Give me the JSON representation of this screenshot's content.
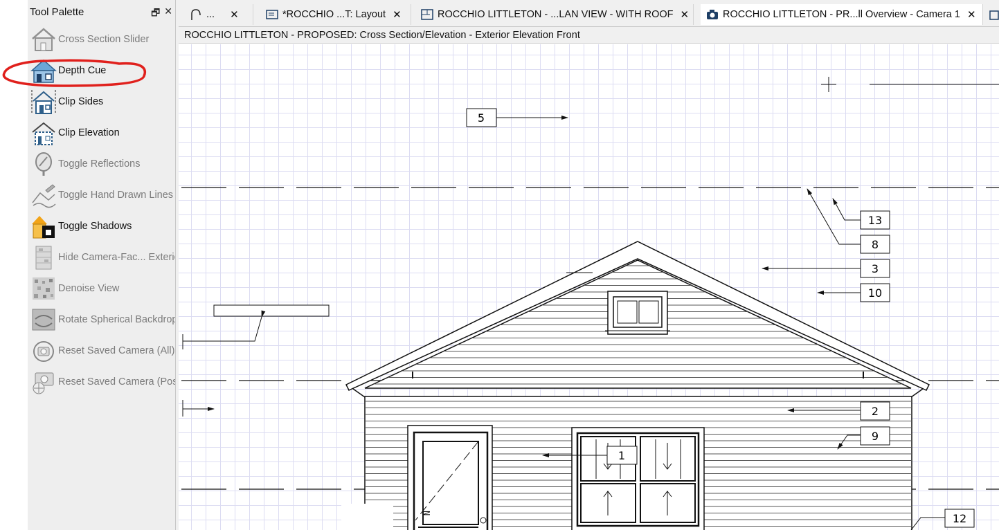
{
  "palette": {
    "title": "Tool Palette",
    "items": [
      {
        "label": "Cross Section Slider",
        "icon": "cross-section-slider-icon",
        "enabled": false
      },
      {
        "label": "Depth Cue",
        "icon": "depth-cue-icon",
        "enabled": true
      },
      {
        "label": "Clip Sides",
        "icon": "clip-sides-icon",
        "enabled": true
      },
      {
        "label": "Clip Elevation",
        "icon": "clip-elevation-icon",
        "enabled": true
      },
      {
        "label": "Toggle Reflections",
        "icon": "reflections-icon",
        "enabled": false
      },
      {
        "label": "Toggle Hand Drawn Lines",
        "icon": "hand-drawn-lines-icon",
        "enabled": false
      },
      {
        "label": "Toggle Shadows",
        "icon": "shadows-icon",
        "enabled": true
      },
      {
        "label": "Hide Camera-Fac... Exterior",
        "icon": "hide-camera-facing-icon",
        "enabled": false
      },
      {
        "label": "Denoise View",
        "icon": "denoise-icon",
        "enabled": false
      },
      {
        "label": "Rotate Spherical Backdrop",
        "icon": "rotate-backdrop-icon",
        "enabled": false
      },
      {
        "label": "Reset Saved Camera (All)",
        "icon": "reset-camera-icon",
        "enabled": false
      },
      {
        "label": "Reset Saved Camera (Position)",
        "icon": "reset-camera-position-icon",
        "enabled": false
      }
    ]
  },
  "tabs": [
    {
      "label": "...",
      "icon": "arc-icon"
    },
    {
      "label": "*ROCCHIO ...T: Layout",
      "icon": "layout-icon"
    },
    {
      "label": "ROCCHIO LITTLETON - ...LAN VIEW - WITH ROOF",
      "icon": "plan-view-icon"
    },
    {
      "label": "ROCCHIO LITTLETON - PR...ll Overview - Camera 1",
      "icon": "camera-icon"
    }
  ],
  "close_glyph": "✕",
  "view_title": "ROCCHIO LITTLETON - PROPOSED: Cross Section/Elevation - Exterior Elevation Front",
  "callouts": [
    "5",
    "13",
    "8",
    "3",
    "10",
    "2",
    "9",
    "1",
    "12"
  ],
  "annotation_color": "#e0201c"
}
